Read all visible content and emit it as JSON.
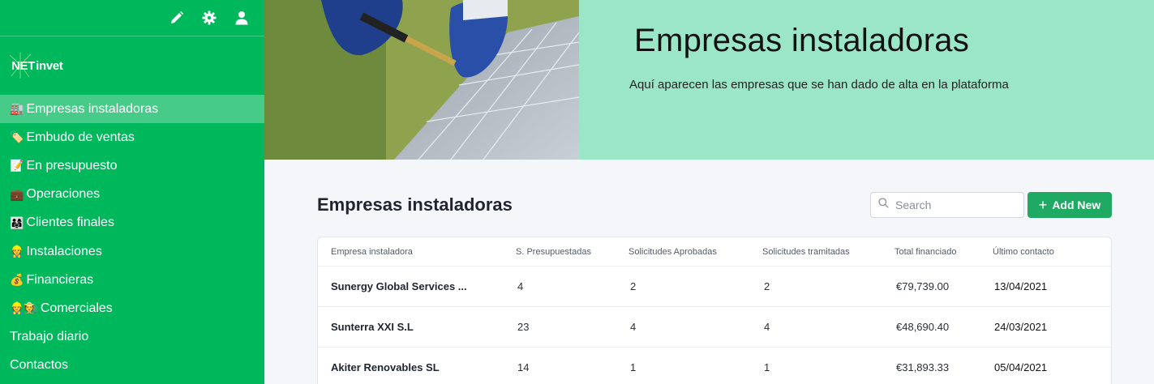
{
  "sidebar": {
    "topbar_icons": [
      "pencil-icon",
      "gear-icon",
      "user-icon"
    ],
    "logo": {
      "part1": "NET",
      "part2": "invet"
    },
    "items": [
      {
        "emoji": "🏭",
        "label": "Empresas instaladoras",
        "active": true
      },
      {
        "emoji": "🏷️",
        "label": "Embudo de ventas",
        "active": false
      },
      {
        "emoji": "📝",
        "label": "En presupuesto",
        "active": false
      },
      {
        "emoji": "💼",
        "label": "Operaciones",
        "active": false
      },
      {
        "emoji": "👨‍👩‍👧",
        "label": "Clientes finales",
        "active": false
      },
      {
        "emoji": "👷",
        "label": "Instalaciones",
        "active": false
      },
      {
        "emoji": "💰",
        "label": "Financieras",
        "active": false
      },
      {
        "emoji": "👷🧑‍🌾",
        "label": "Comerciales",
        "active": false
      },
      {
        "emoji": "",
        "label": "Trabajo diario",
        "active": false
      },
      {
        "emoji": "",
        "label": "Contactos",
        "active": false
      }
    ]
  },
  "hero": {
    "title": "Empresas instaladoras",
    "subtitle": "Aquí aparecen las empresas que se han dado de alta en la plataforma"
  },
  "main": {
    "title": "Empresas instaladoras",
    "search": {
      "placeholder": "Search",
      "value": ""
    },
    "add_button": "Add New",
    "table": {
      "columns": [
        "Empresa instaladora",
        "S. Presupuestadas",
        "Solicitudes Aprobadas",
        "Solicitudes tramitadas",
        "Total financiado",
        "Último contacto"
      ],
      "rows": [
        [
          "Sunergy Global Services ...",
          "4",
          "2",
          "2",
          "€79,739.00",
          "13/04/2021"
        ],
        [
          "Sunterra XXI S.L",
          "23",
          "4",
          "4",
          "€48,690.40",
          "24/03/2021"
        ],
        [
          "Akiter Renovables SL",
          "14",
          "1",
          "1",
          "€31,893.33",
          "05/04/2021"
        ]
      ]
    }
  },
  "colors": {
    "sidebar": "#00b85c",
    "hero": "#9ce6c8",
    "accent": "#1faa63",
    "background": "#f5f6fa"
  }
}
